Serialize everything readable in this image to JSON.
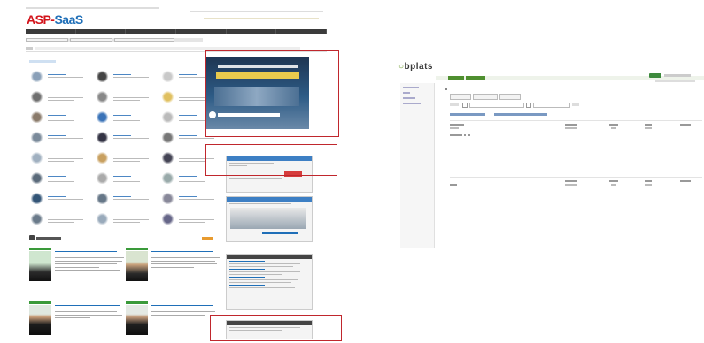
{
  "left_panel": {
    "logo_text": "ASP-",
    "logo_text_b": "SaaS",
    "nav_items": [
      "",
      "",
      "",
      "",
      "",
      ""
    ],
    "subnav_items": [
      "",
      "",
      ""
    ],
    "section_title": "",
    "categories": [
      {
        "icon": "monitor-icon"
      },
      {
        "icon": "person-icon"
      },
      {
        "icon": "ruler-icon"
      },
      {
        "icon": "box-icon"
      },
      {
        "icon": "lock-icon"
      },
      {
        "icon": "folder-icon"
      },
      {
        "icon": "truck-icon"
      },
      {
        "icon": "phone-icon"
      },
      {
        "icon": "document-icon"
      },
      {
        "icon": "car-icon"
      },
      {
        "icon": "network-icon"
      },
      {
        "icon": "headset-icon"
      },
      {
        "icon": "house-icon"
      },
      {
        "icon": "gift-icon"
      },
      {
        "icon": "chart-icon"
      },
      {
        "icon": "pen-icon"
      },
      {
        "icon": "clipboard-icon"
      },
      {
        "icon": "magnifier-icon"
      },
      {
        "icon": "server-icon"
      },
      {
        "icon": "tablet-icon"
      },
      {
        "icon": "building-icon"
      },
      {
        "icon": "printer-icon"
      },
      {
        "icon": "chart-icon"
      },
      {
        "icon": "question-icon"
      }
    ],
    "news_title": "",
    "banner": {
      "line1": "",
      "line2": "",
      "logo": ""
    }
  },
  "right_panel": {
    "logo_text": "bplats"
  },
  "colors": {
    "highlight": "#c0272d",
    "brand_red": "#d3141b",
    "brand_blue": "#1f6fb8",
    "app_green": "#4f8f2f"
  }
}
